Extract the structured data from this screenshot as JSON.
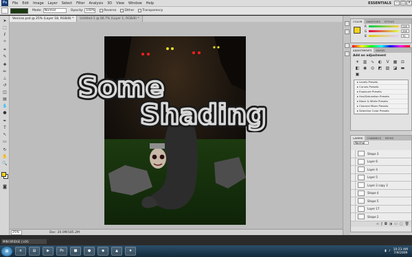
{
  "menubar": {
    "logo": "Ps",
    "items": [
      "File",
      "Edit",
      "Image",
      "Layer",
      "Select",
      "Filter",
      "Analysis",
      "3D",
      "View",
      "Window",
      "Help"
    ],
    "workspace": "ESSENTIALS"
  },
  "options": {
    "mode_label": "Mode:",
    "mode_value": "Normal",
    "opacity_label": "Opacity:",
    "opacity_value": "100%",
    "reverse_label": "Reverse",
    "dither_label": "Dither",
    "transparency_label": "Transparency"
  },
  "doc_tabs": [
    "Venicos.psd @ 25% (Layer 18, RGB/8) *",
    "Untitled-1 @ 66.7% (Layer 1, RGB/8) *"
  ],
  "artwork": {
    "caption_line1": "Some",
    "caption_line2": "Shading"
  },
  "status": {
    "zoom": "25%",
    "doc_size": "Doc: 20.0M/185.2M"
  },
  "minibridge_label": "MINI BRIDGE | LOG",
  "panels": {
    "color_tabs": [
      "COLOR",
      "SWATCHES",
      "STYLES"
    ],
    "color_sliders": [
      {
        "channel": "R",
        "value": "226"
      },
      {
        "channel": "G",
        "value": "206"
      },
      {
        "channel": "B",
        "value": "70"
      }
    ],
    "adjust_tabs": [
      "ADJUSTMENTS",
      "MASKS"
    ],
    "adjust_title": "Add an adjustment",
    "adjust_presets": [
      "Levels Presets",
      "Curves Presets",
      "Exposure Presets",
      "Hue/Saturation Presets",
      "Black & White Presets",
      "Channel Mixer Presets",
      "Selective Color Presets"
    ],
    "layers_tabs": [
      "LAYERS",
      "CHANNELS",
      "PATHS"
    ],
    "blend_mode": "Normal",
    "layers": [
      "Shape 3",
      "Layer 6",
      "Layer 4",
      "Layer 5",
      "Layer 2 copy 3",
      "Shape 4",
      "Shape 5",
      "Layer 17",
      "Shape 2"
    ]
  },
  "taskbar": {
    "time": "10:23 AM",
    "date": "7/9/2009"
  }
}
